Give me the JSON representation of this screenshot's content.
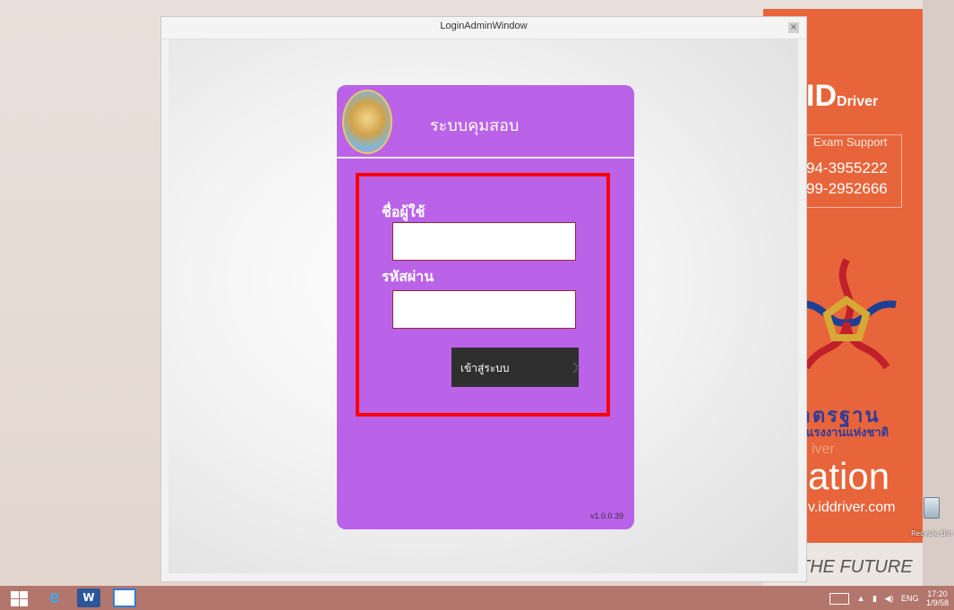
{
  "window": {
    "title": "LoginAdminWindow",
    "close_label": "×"
  },
  "login": {
    "title": "ระบบคุมสอบ",
    "username_label": "ชื่อผู้ใช้",
    "username_value": "",
    "password_label": "รหัสผ่าน",
    "password_value": "",
    "login_button": "เข้าสู่ระบบ",
    "login_button_icon": "double-chevron-right",
    "version": "v1.0.0.39",
    "highlight_color": "#ff0000"
  },
  "background": {
    "brand_id": "ID",
    "brand_driver": "river",
    "support_title": "Exam Support",
    "phone_1": "94-3955222",
    "phone_2": "99-2952666",
    "thai_line_1": "มาตรฐาน",
    "thai_line_2": "ฝีมือแรงงานแห่งชาติ",
    "tagline_small": "iver",
    "tagline_big": "ation",
    "website": "v.iddriver.com",
    "slogan": "THE FUTURE",
    "recycle_bin": "Recycle Bin",
    "accent_color": "#e8643a",
    "card_color": "#ba63e8"
  },
  "taskbar": {
    "apps": [
      "start-icon",
      "internet-explorer-icon",
      "word-icon",
      "window-icon"
    ],
    "language": "ENG",
    "time": "17:20",
    "date": "1/9/58"
  }
}
